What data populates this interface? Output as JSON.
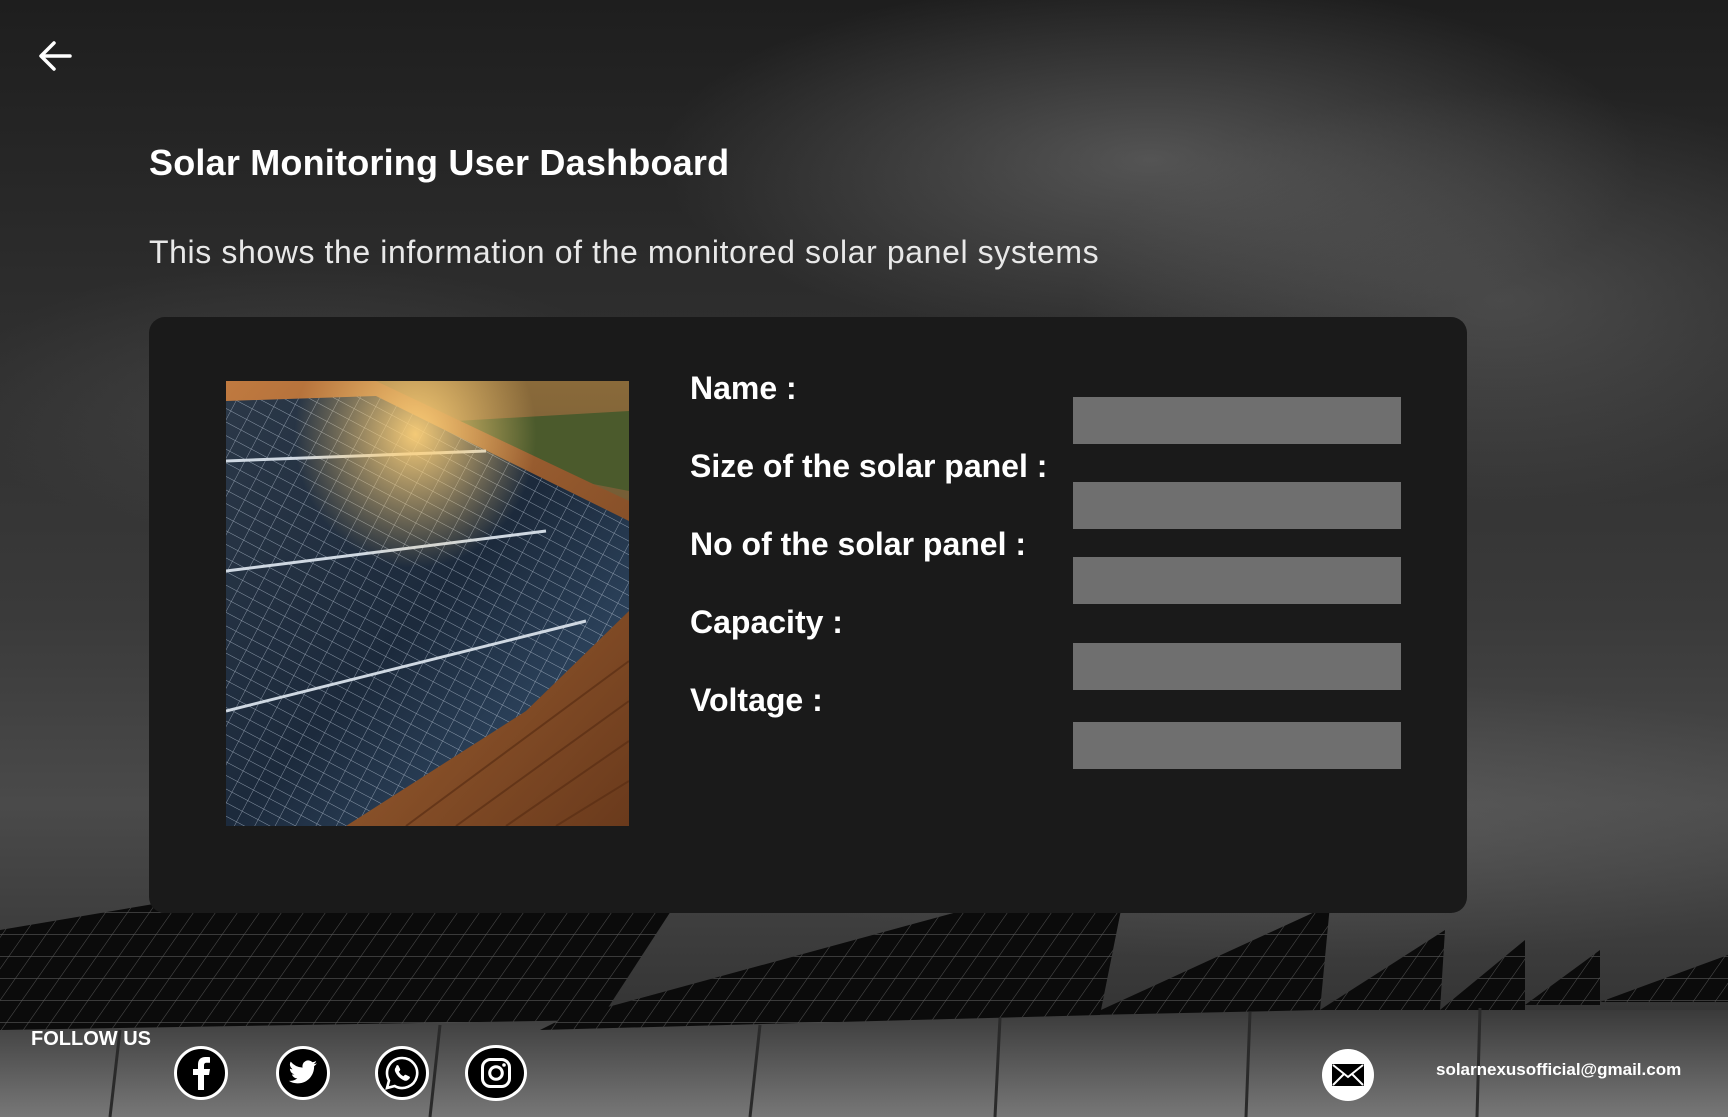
{
  "header": {
    "back_icon": "arrow-left-icon",
    "title": "Solar Monitoring User Dashboard",
    "subtitle": "This shows the information of the monitored solar panel systems"
  },
  "card": {
    "image_name": "rooftop-solar-panels",
    "fields": [
      {
        "label": "Name :",
        "value": ""
      },
      {
        "label": "Size of the solar panel :",
        "value": ""
      },
      {
        "label": "No of the solar panel :",
        "value": ""
      },
      {
        "label": "Capacity :",
        "value": ""
      },
      {
        "label": "Voltage :",
        "value": ""
      }
    ]
  },
  "footer": {
    "follow_label": "FOLLOW US",
    "social_icons": [
      "facebook-icon",
      "twitter-icon",
      "whatsapp-icon",
      "instagram-icon"
    ],
    "mail_icon": "mail-icon",
    "email": "solarnexusofficial@gmail.com"
  },
  "colors": {
    "card_background": "#1a1a1a",
    "field_background": "#6f6f6f",
    "text": "#ffffff"
  }
}
